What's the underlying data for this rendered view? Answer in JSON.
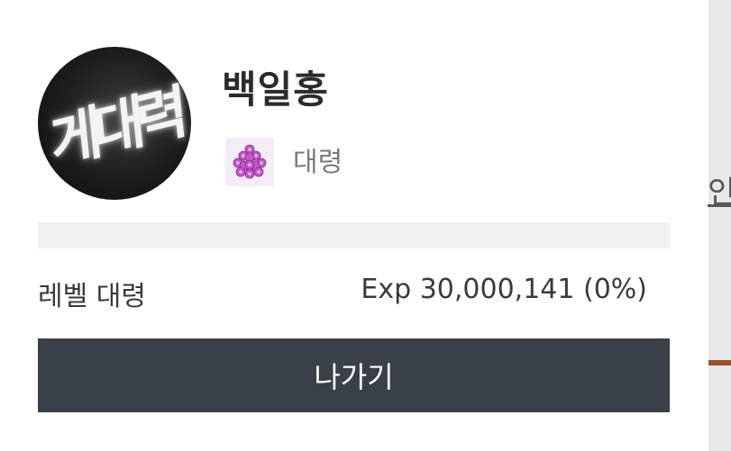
{
  "profile": {
    "avatar_text": "게대력",
    "name": "백일홍",
    "rank": "대령",
    "rank_icon": "purple-flower-icon"
  },
  "progress": {
    "fraction": 0.0
  },
  "stats": {
    "level_label": "레벨 대령",
    "exp_text": "Exp 30,000,141 (0%)"
  },
  "actions": {
    "exit_label": "나가기"
  },
  "background": {
    "partial_text": "인"
  },
  "colors": {
    "button_bg": "#3a4048",
    "rank_color": "#b040b0",
    "text_dark": "#2b2b2b",
    "text_muted": "#7a7a7a"
  }
}
